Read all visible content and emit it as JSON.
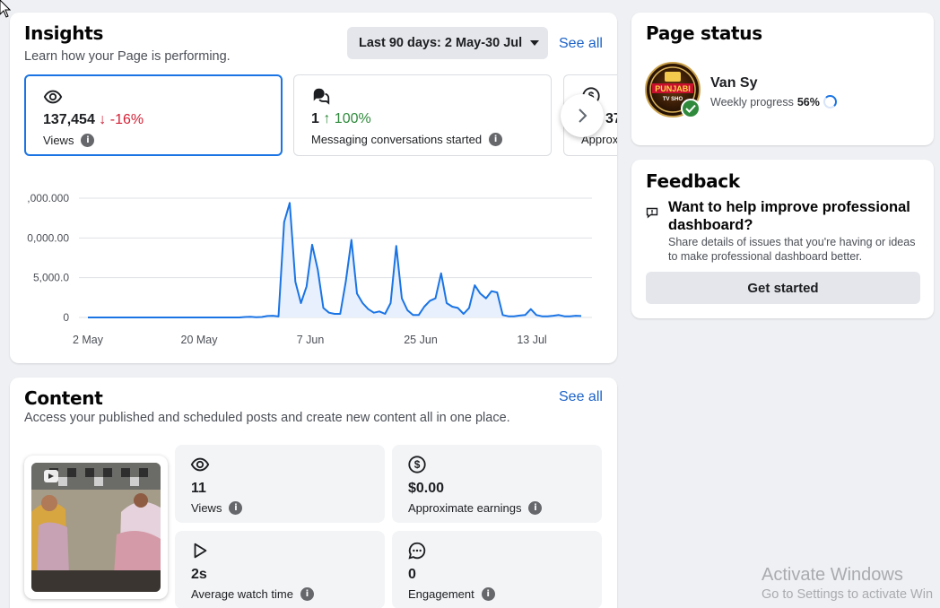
{
  "insights": {
    "title": "Insights",
    "subtitle": "Learn how your Page is performing.",
    "date_range": "Last 90 days: 2 May-30 Jul",
    "see_all": "See all",
    "metrics": [
      {
        "icon": "eye-icon",
        "value": "137,454",
        "change": "↓ -16%",
        "direction": "down",
        "label": "Views"
      },
      {
        "icon": "chat-bubbles-icon",
        "value": "1",
        "change": "↑ 100%",
        "direction": "up",
        "label": "Messaging conversations started"
      },
      {
        "icon": "dollar-circle-icon",
        "value": "37",
        "label": "Approx"
      }
    ]
  },
  "chart_data": {
    "type": "area",
    "series": [
      {
        "values": [
          0,
          0,
          0,
          0,
          0,
          0,
          0,
          0,
          0,
          0,
          0,
          0,
          0,
          0,
          0,
          0,
          0,
          0,
          0,
          0,
          0,
          0,
          0,
          0,
          0,
          0,
          0,
          0,
          200,
          300,
          100,
          200,
          600,
          700,
          400,
          40000,
          48000,
          15000,
          6000,
          13000,
          30500,
          20000,
          4000,
          2000,
          1500,
          1500,
          15000,
          32500,
          10000,
          6000,
          3500,
          2000,
          2500,
          1500,
          6000,
          30000,
          8000,
          3000,
          1000,
          1000,
          4500,
          7000,
          8000,
          18500,
          6000,
          4500,
          4000,
          1500,
          4000,
          13500,
          10000,
          8000,
          11000,
          10500,
          1000,
          500,
          500,
          800,
          1000,
          3500,
          1000,
          500,
          500,
          700,
          1000,
          500,
          500,
          700,
          600
        ]
      }
    ],
    "x_ticks": [
      "2 May",
      "20 May",
      "7 Jun",
      "25 Jun",
      "13 Jul"
    ],
    "y_ticks": [
      "0",
      "5,000.0",
      "0,000.00",
      ",000.000"
    ],
    "ylim": [
      0,
      50000
    ],
    "grid": true,
    "colors": {
      "line": "#1b74e4",
      "fill": "#e7f0fc",
      "grid": "#dfe1e5"
    }
  },
  "content": {
    "title": "Content",
    "subtitle": "Access your published and scheduled posts and create new content all in one place.",
    "see_all": "See all",
    "stats": [
      {
        "icon": "eye-icon",
        "value": "11",
        "label": "Views"
      },
      {
        "icon": "dollar-circle-icon",
        "value": "$0.00",
        "label": "Approximate earnings"
      },
      {
        "icon": "play-icon",
        "value": "2s",
        "label": "Average watch time"
      },
      {
        "icon": "chat-bubble-icon",
        "value": "0",
        "label": "Engagement"
      }
    ]
  },
  "page_status": {
    "title": "Page status",
    "name": "Van Sy",
    "progress_label": "Weekly progress",
    "progress_value": "56%",
    "progress_fraction": 0.56,
    "avatar_text": "PUNJABI TV SHO"
  },
  "feedback": {
    "title": "Feedback",
    "question": "Want to help improve professional dashboard?",
    "description": "Share details of issues that you're having or ideas to make professional dashboard better.",
    "button": "Get started"
  },
  "watermark": {
    "line1": "Activate Windows",
    "line2": "Go to Settings to activate Win"
  },
  "colors": {
    "accent": "#1b74e4",
    "link": "#1d63c8",
    "down": "#d32035",
    "up": "#2f8a3c"
  }
}
